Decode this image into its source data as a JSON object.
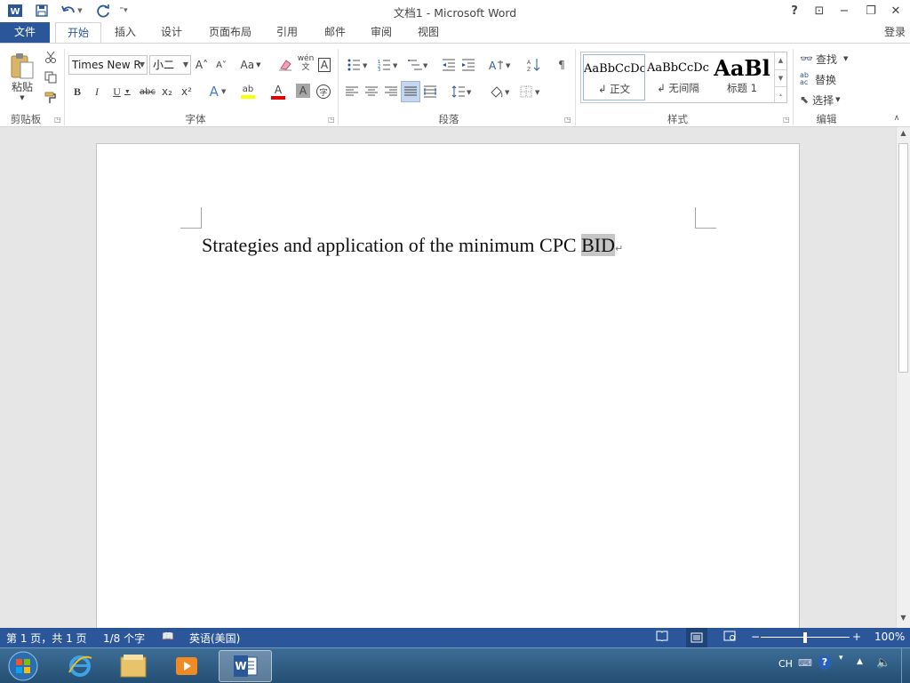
{
  "titlebar": {
    "title": "文档1 - Microsoft Word",
    "help": "?",
    "ribbon_display": "⊡",
    "minimize": "−",
    "restore": "❐",
    "close": "✕"
  },
  "tabs": {
    "file": "文件",
    "items": [
      "开始",
      "插入",
      "设计",
      "页面布局",
      "引用",
      "邮件",
      "审阅",
      "视图"
    ],
    "sign_in": "登录"
  },
  "ribbon": {
    "clipboard": {
      "paste": "粘贴",
      "group": "剪贴板"
    },
    "font": {
      "font_name": "Times New R",
      "font_size": "小二",
      "group": "字体",
      "grow": "A˄",
      "shrink": "A˅",
      "change_case": "Aa",
      "phonetic": "wén\n文",
      "border_char": "A",
      "bold": "B",
      "italic": "I",
      "underline": "U",
      "strike": "abc",
      "subscript": "x₂",
      "superscript": "x²",
      "effects": "A",
      "highlight": "ab",
      "font_color": "A",
      "char_shading": "A",
      "enclose": "字"
    },
    "paragraph": {
      "group": "段落"
    },
    "styles": {
      "group": "样式",
      "items": [
        {
          "preview": "AaBbCcDc",
          "name": "↲ 正文"
        },
        {
          "preview": "AaBbCcDc",
          "name": "↲ 无间隔"
        },
        {
          "preview": "AaBl",
          "name": "标题 1"
        }
      ]
    },
    "editing": {
      "group": "编辑",
      "find": "查找",
      "replace": "替换",
      "select": "选择"
    }
  },
  "document": {
    "text_before": "Strategies and application of the minimum CPC ",
    "text_selected": "BID",
    "paragraph_mark": "↵"
  },
  "statusbar": {
    "page": "第 1 页，共 1 页",
    "words": "1/8 个字",
    "language": "英语(美国)",
    "zoom": "100%",
    "zoom_minus": "−",
    "zoom_plus": "+"
  },
  "taskbar": {
    "ime": "CH"
  },
  "colors": {
    "accent": "#2b579a",
    "highlight_yellow": "#ffff00",
    "font_red": "#e00000"
  }
}
